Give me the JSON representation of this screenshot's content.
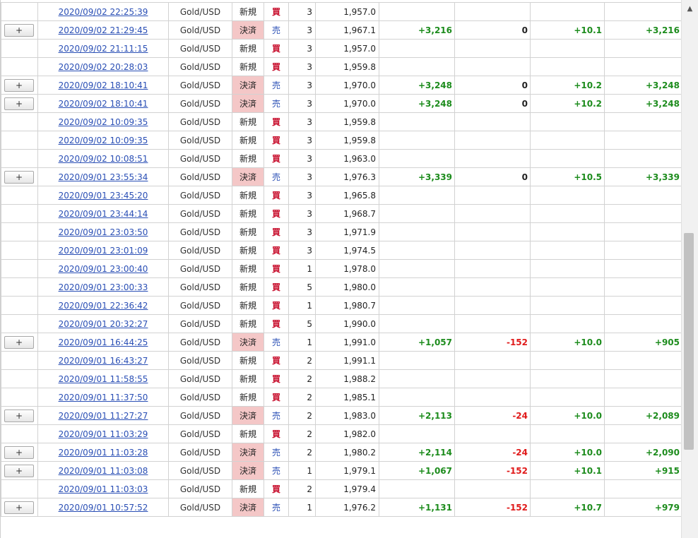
{
  "rows": [
    {
      "btn": "",
      "time": "2020/09/02 22:25:39",
      "pair": "Gold/USD",
      "kind": "新規",
      "side": "買",
      "qty": "3",
      "price": "1,957.0",
      "pl": "",
      "swap": "",
      "pips": "",
      "net": ""
    },
    {
      "btn": "+",
      "time": "2020/09/02 21:29:45",
      "pair": "Gold/USD",
      "kind": "決済",
      "side": "売",
      "qty": "3",
      "price": "1,967.1",
      "pl": "+3,216",
      "swap": "0",
      "pips": "+10.1",
      "net": "+3,216"
    },
    {
      "btn": "",
      "time": "2020/09/02 21:11:15",
      "pair": "Gold/USD",
      "kind": "新規",
      "side": "買",
      "qty": "3",
      "price": "1,957.0",
      "pl": "",
      "swap": "",
      "pips": "",
      "net": ""
    },
    {
      "btn": "",
      "time": "2020/09/02 20:28:03",
      "pair": "Gold/USD",
      "kind": "新規",
      "side": "買",
      "qty": "3",
      "price": "1,959.8",
      "pl": "",
      "swap": "",
      "pips": "",
      "net": ""
    },
    {
      "btn": "+",
      "time": "2020/09/02 18:10:41",
      "pair": "Gold/USD",
      "kind": "決済",
      "side": "売",
      "qty": "3",
      "price": "1,970.0",
      "pl": "+3,248",
      "swap": "0",
      "pips": "+10.2",
      "net": "+3,248"
    },
    {
      "btn": "+",
      "time": "2020/09/02 18:10:41",
      "pair": "Gold/USD",
      "kind": "決済",
      "side": "売",
      "qty": "3",
      "price": "1,970.0",
      "pl": "+3,248",
      "swap": "0",
      "pips": "+10.2",
      "net": "+3,248"
    },
    {
      "btn": "",
      "time": "2020/09/02 10:09:35",
      "pair": "Gold/USD",
      "kind": "新規",
      "side": "買",
      "qty": "3",
      "price": "1,959.8",
      "pl": "",
      "swap": "",
      "pips": "",
      "net": ""
    },
    {
      "btn": "",
      "time": "2020/09/02 10:09:35",
      "pair": "Gold/USD",
      "kind": "新規",
      "side": "買",
      "qty": "3",
      "price": "1,959.8",
      "pl": "",
      "swap": "",
      "pips": "",
      "net": ""
    },
    {
      "btn": "",
      "time": "2020/09/02 10:08:51",
      "pair": "Gold/USD",
      "kind": "新規",
      "side": "買",
      "qty": "3",
      "price": "1,963.0",
      "pl": "",
      "swap": "",
      "pips": "",
      "net": ""
    },
    {
      "btn": "+",
      "time": "2020/09/01 23:55:34",
      "pair": "Gold/USD",
      "kind": "決済",
      "side": "売",
      "qty": "3",
      "price": "1,976.3",
      "pl": "+3,339",
      "swap": "0",
      "pips": "+10.5",
      "net": "+3,339"
    },
    {
      "btn": "",
      "time": "2020/09/01 23:45:20",
      "pair": "Gold/USD",
      "kind": "新規",
      "side": "買",
      "qty": "3",
      "price": "1,965.8",
      "pl": "",
      "swap": "",
      "pips": "",
      "net": ""
    },
    {
      "btn": "",
      "time": "2020/09/01 23:44:14",
      "pair": "Gold/USD",
      "kind": "新規",
      "side": "買",
      "qty": "3",
      "price": "1,968.7",
      "pl": "",
      "swap": "",
      "pips": "",
      "net": ""
    },
    {
      "btn": "",
      "time": "2020/09/01 23:03:50",
      "pair": "Gold/USD",
      "kind": "新規",
      "side": "買",
      "qty": "3",
      "price": "1,971.9",
      "pl": "",
      "swap": "",
      "pips": "",
      "net": ""
    },
    {
      "btn": "",
      "time": "2020/09/01 23:01:09",
      "pair": "Gold/USD",
      "kind": "新規",
      "side": "買",
      "qty": "3",
      "price": "1,974.5",
      "pl": "",
      "swap": "",
      "pips": "",
      "net": ""
    },
    {
      "btn": "",
      "time": "2020/09/01 23:00:40",
      "pair": "Gold/USD",
      "kind": "新規",
      "side": "買",
      "qty": "1",
      "price": "1,978.0",
      "pl": "",
      "swap": "",
      "pips": "",
      "net": ""
    },
    {
      "btn": "",
      "time": "2020/09/01 23:00:33",
      "pair": "Gold/USD",
      "kind": "新規",
      "side": "買",
      "qty": "5",
      "price": "1,980.0",
      "pl": "",
      "swap": "",
      "pips": "",
      "net": ""
    },
    {
      "btn": "",
      "time": "2020/09/01 22:36:42",
      "pair": "Gold/USD",
      "kind": "新規",
      "side": "買",
      "qty": "1",
      "price": "1,980.7",
      "pl": "",
      "swap": "",
      "pips": "",
      "net": ""
    },
    {
      "btn": "",
      "time": "2020/09/01 20:32:27",
      "pair": "Gold/USD",
      "kind": "新規",
      "side": "買",
      "qty": "5",
      "price": "1,990.0",
      "pl": "",
      "swap": "",
      "pips": "",
      "net": ""
    },
    {
      "btn": "+",
      "time": "2020/09/01 16:44:25",
      "pair": "Gold/USD",
      "kind": "決済",
      "side": "売",
      "qty": "1",
      "price": "1,991.0",
      "pl": "+1,057",
      "swap": "-152",
      "pips": "+10.0",
      "net": "+905"
    },
    {
      "btn": "",
      "time": "2020/09/01 16:43:27",
      "pair": "Gold/USD",
      "kind": "新規",
      "side": "買",
      "qty": "2",
      "price": "1,991.1",
      "pl": "",
      "swap": "",
      "pips": "",
      "net": ""
    },
    {
      "btn": "",
      "time": "2020/09/01 11:58:55",
      "pair": "Gold/USD",
      "kind": "新規",
      "side": "買",
      "qty": "2",
      "price": "1,988.2",
      "pl": "",
      "swap": "",
      "pips": "",
      "net": ""
    },
    {
      "btn": "",
      "time": "2020/09/01 11:37:50",
      "pair": "Gold/USD",
      "kind": "新規",
      "side": "買",
      "qty": "2",
      "price": "1,985.1",
      "pl": "",
      "swap": "",
      "pips": "",
      "net": ""
    },
    {
      "btn": "+",
      "time": "2020/09/01 11:27:27",
      "pair": "Gold/USD",
      "kind": "決済",
      "side": "売",
      "qty": "2",
      "price": "1,983.0",
      "pl": "+2,113",
      "swap": "-24",
      "pips": "+10.0",
      "net": "+2,089"
    },
    {
      "btn": "",
      "time": "2020/09/01 11:03:29",
      "pair": "Gold/USD",
      "kind": "新規",
      "side": "買",
      "qty": "2",
      "price": "1,982.0",
      "pl": "",
      "swap": "",
      "pips": "",
      "net": ""
    },
    {
      "btn": "+",
      "time": "2020/09/01 11:03:28",
      "pair": "Gold/USD",
      "kind": "決済",
      "side": "売",
      "qty": "2",
      "price": "1,980.2",
      "pl": "+2,114",
      "swap": "-24",
      "pips": "+10.0",
      "net": "+2,090"
    },
    {
      "btn": "+",
      "time": "2020/09/01 11:03:08",
      "pair": "Gold/USD",
      "kind": "決済",
      "side": "売",
      "qty": "1",
      "price": "1,979.1",
      "pl": "+1,067",
      "swap": "-152",
      "pips": "+10.1",
      "net": "+915"
    },
    {
      "btn": "",
      "time": "2020/09/01 11:03:03",
      "pair": "Gold/USD",
      "kind": "新規",
      "side": "買",
      "qty": "2",
      "price": "1,979.4",
      "pl": "",
      "swap": "",
      "pips": "",
      "net": ""
    },
    {
      "btn": "+",
      "time": "2020/09/01 10:57:52",
      "pair": "Gold/USD",
      "kind": "決済",
      "side": "売",
      "qty": "1",
      "price": "1,976.2",
      "pl": "+1,131",
      "swap": "-152",
      "pips": "+10.7",
      "net": "+979"
    }
  ],
  "colors": {
    "link": "#2a4fb5",
    "buy": "#c8102e",
    "sell": "#2a4fb5",
    "settle_bg": "#f4c7c7",
    "positive": "#1d8c1d",
    "negative": "#e01a1a"
  },
  "scrollbar": {
    "up_icon": "triangle-up-icon"
  }
}
